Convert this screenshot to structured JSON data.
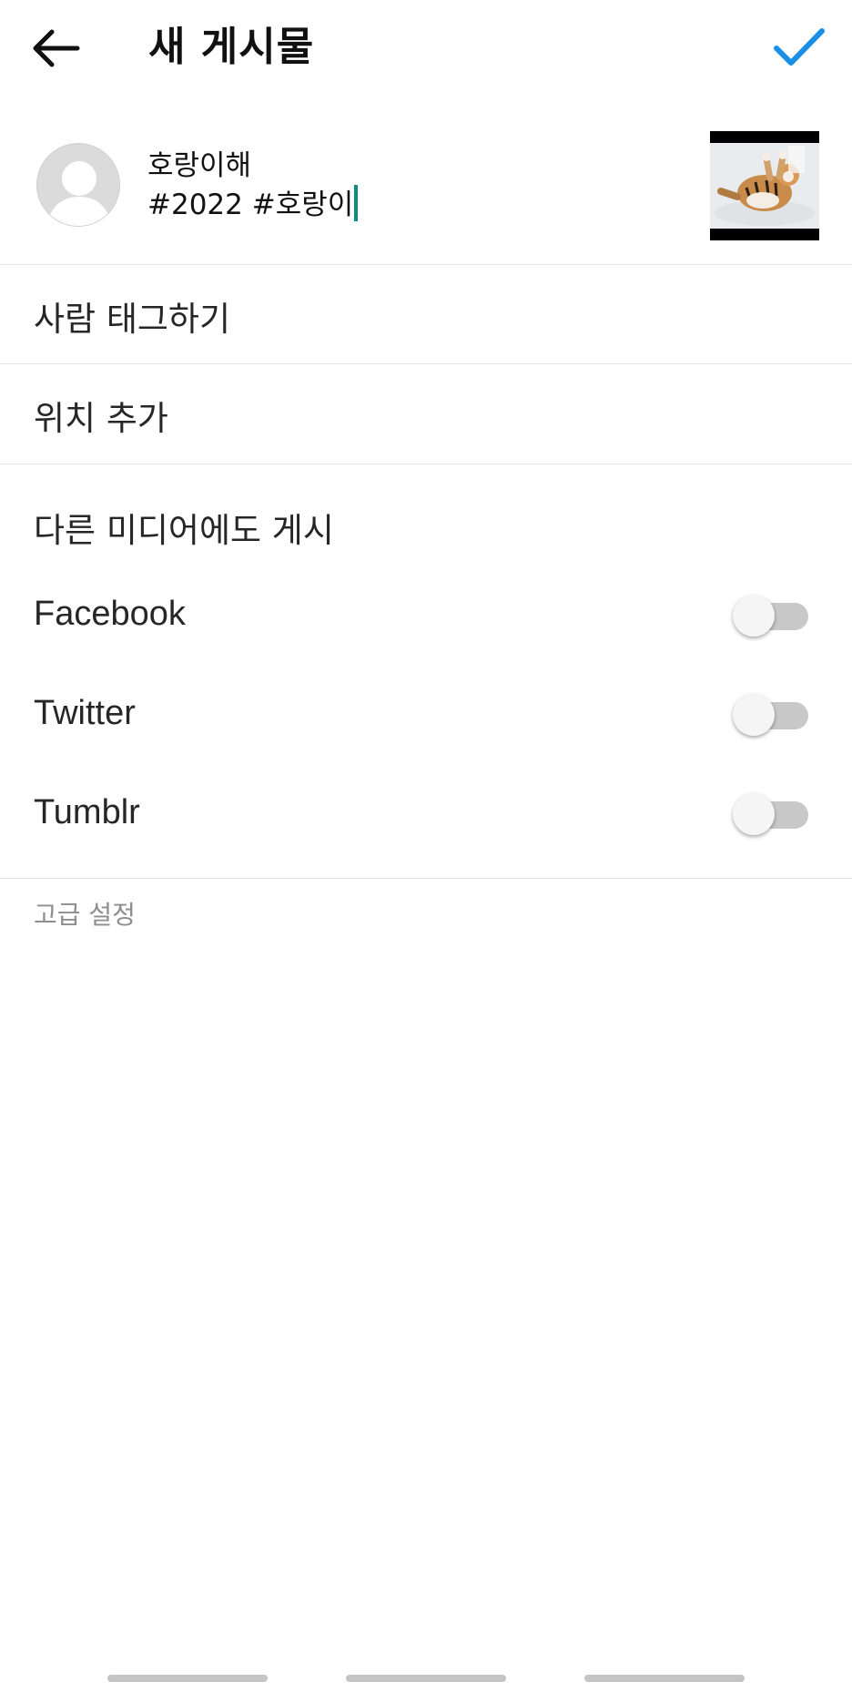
{
  "header": {
    "title": "새 게시물",
    "back_icon": "arrow-left-icon",
    "confirm_icon": "check-icon",
    "accent_color": "#1b8fe6"
  },
  "compose": {
    "avatar_icon": "default-avatar-icon",
    "caption_line1": "호랑이해",
    "caption_line2": "#2022 #호랑이",
    "thumbnail": "tiger-photo-thumbnail"
  },
  "menu": {
    "tag_people": "사람 태그하기",
    "add_location": "위치 추가"
  },
  "share": {
    "section_title": "다른 미디어에도 게시",
    "items": [
      {
        "label": "Facebook",
        "enabled": false
      },
      {
        "label": "Twitter",
        "enabled": false
      },
      {
        "label": "Tumblr",
        "enabled": false
      }
    ]
  },
  "advanced": {
    "label": "고급 설정"
  }
}
